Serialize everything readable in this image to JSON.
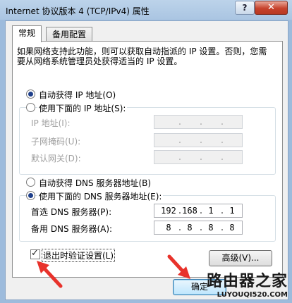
{
  "window": {
    "title": "Internet 协议版本 4 (TCP/IPv4) 属性",
    "help": "?",
    "close": "✕"
  },
  "tabs": [
    {
      "label": "常规"
    },
    {
      "label": "备用配置"
    }
  ],
  "description": "如果网络支持此功能，则可以获取自动指派的 IP 设置。否则，您需要从网络系统管理员处获得适当的 IP 设置。",
  "ip": {
    "auto_label": "自动获得 IP 地址(O)",
    "manual_label": "使用下面的 IP 地址(S):",
    "fields": [
      {
        "label": "IP 地址(I):"
      },
      {
        "label": "子网掩码(U):"
      },
      {
        "label": "默认网关(D):"
      }
    ]
  },
  "dns": {
    "auto_label": "自动获得 DNS 服务器地址(B)",
    "manual_label": "使用下面的 DNS 服务器地址(E):",
    "preferred_label": "首选 DNS 服务器(P):",
    "preferred_octets": [
      "192",
      "168",
      "1",
      "1"
    ],
    "alternate_label": "备用 DNS 服务器(A):",
    "alternate_octets": [
      "8",
      "8",
      "8",
      "8"
    ]
  },
  "validate": {
    "label": "退出时验证设置(L)",
    "checked": true
  },
  "buttons": {
    "advanced": "高级(V)...",
    "ok": "确定"
  },
  "watermark": {
    "name": "路由器之家",
    "url": "LUYOUQI520.COM"
  },
  "colors": {
    "arrow": "#e8322b",
    "accent": "#1e3f8a"
  }
}
